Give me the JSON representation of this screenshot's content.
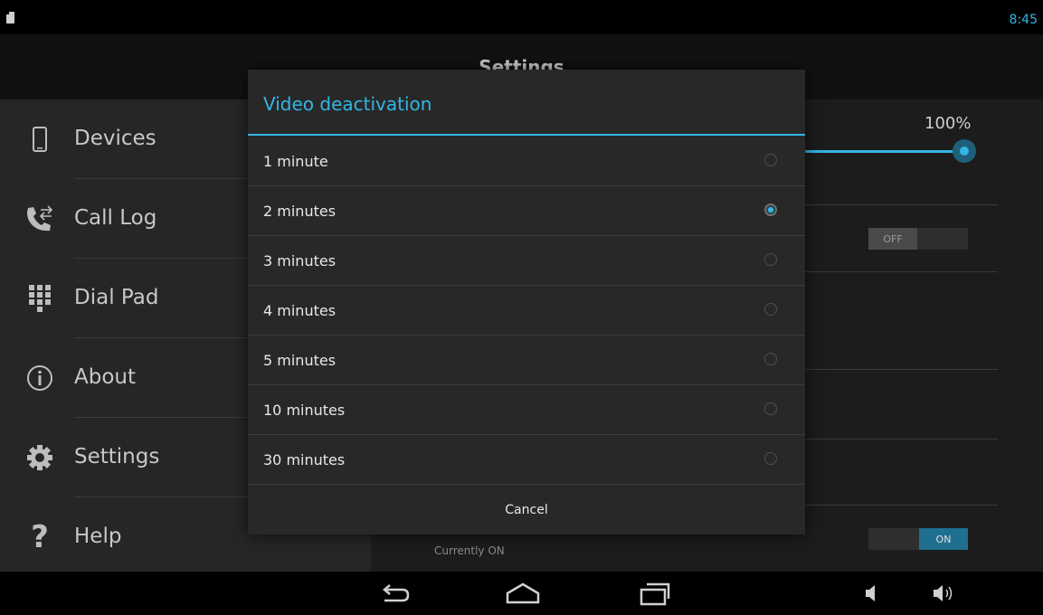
{
  "status_bar": {
    "time": "8:45",
    "icons": [
      "sd-card-icon"
    ]
  },
  "header": {
    "title": "Settings"
  },
  "sidebar": {
    "items": [
      {
        "label": "Devices",
        "icon": "phone-icon"
      },
      {
        "label": "Call Log",
        "icon": "call-log-icon"
      },
      {
        "label": "Dial Pad",
        "icon": "dialpad-icon"
      },
      {
        "label": "About",
        "icon": "info-icon"
      },
      {
        "label": "Settings",
        "icon": "gear-icon"
      },
      {
        "label": "Help",
        "icon": "question-icon"
      }
    ]
  },
  "content": {
    "volume_percent": "100%",
    "volume_level": 1.0,
    "toggle_off_label": "OFF",
    "toggle_on_label": "ON",
    "currently_text": "Currently ON"
  },
  "dialog": {
    "title": "Video deactivation",
    "options": [
      {
        "label": "1 minute",
        "selected": false
      },
      {
        "label": "2 minutes",
        "selected": true
      },
      {
        "label": "3 minutes",
        "selected": false
      },
      {
        "label": "4 minutes",
        "selected": false
      },
      {
        "label": "5 minutes",
        "selected": false
      },
      {
        "label": "10 minutes",
        "selected": false
      },
      {
        "label": "30 minutes",
        "selected": false
      }
    ],
    "cancel_label": "Cancel"
  },
  "nav_bar": {
    "icons": [
      "back-icon",
      "home-icon",
      "recents-icon",
      "volume-down-icon",
      "volume-up-icon"
    ]
  },
  "colors": {
    "accent": "#33b5e5",
    "dialog_bg": "#282828",
    "sidebar_bg": "#262626"
  }
}
